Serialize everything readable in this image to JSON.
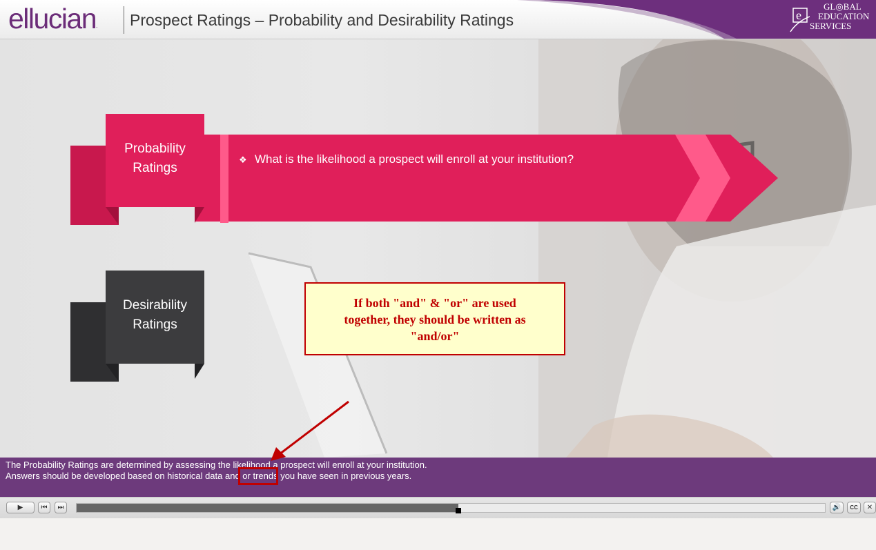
{
  "header": {
    "brand": "ellucian",
    "brand_mark": ".",
    "title": "Prospect Ratings – Probability and Desirability Ratings",
    "badge_lines": [
      "GL◎BAL",
      "EDUCATION",
      "SERVICES"
    ]
  },
  "slide": {
    "probability_tab": [
      "Probability",
      "Ratings"
    ],
    "desirability_tab": [
      "Desirability",
      "Ratings"
    ],
    "bullet_icon": "diamond-bullet-icon",
    "bullet_text": "What is the likelihood a prospect will enroll at your institution?",
    "colors": {
      "accent": "#e01f5a",
      "dark": "#3c3c3e",
      "caption": "#6d3a7c"
    }
  },
  "callout": {
    "lines": [
      "If both \"and\" & \"or\" are used",
      "together, they should be written as",
      "\"and/or\""
    ]
  },
  "caption": {
    "line1": "The Probability Ratings are determined by assessing the likelihood a prospect will enroll at your institution.",
    "line2": "Answers should be developed based on historical data and or trends you have seen in previous years."
  },
  "player": {
    "progress": 0.51,
    "buttons": {
      "play": "▶",
      "prev": "⏮",
      "next": "⏭",
      "volume": "🔊",
      "cc": "CC",
      "close": "✕"
    }
  }
}
